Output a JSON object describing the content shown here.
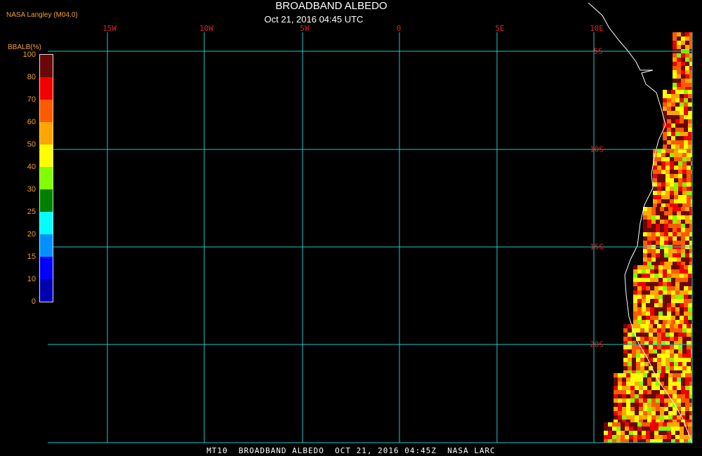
{
  "header": {
    "title": "BROADBAND ALBEDO",
    "subtitle": "Oct 21, 2016 04:45 UTC",
    "credit": "NASA Langley (M04.0)"
  },
  "legend": {
    "unit_label": "BBALB(%)",
    "ticks": [
      "100",
      "80",
      "70",
      "60",
      "50",
      "40",
      "30",
      "25",
      "20",
      "15",
      "10",
      "0"
    ],
    "colors": [
      "#6a0808",
      "#f00000",
      "#ff5a00",
      "#ffa500",
      "#ffff00",
      "#80ff00",
      "#008000",
      "#00ffff",
      "#0090ff",
      "#0000ff",
      "#0000b0",
      "#9030e0"
    ]
  },
  "grid": {
    "color": "#20c8c8",
    "lon_labels": [
      "15W",
      "10W",
      "5W",
      "0",
      "5E",
      "10E"
    ],
    "lat_labels": [
      "5S",
      "10S",
      "15S",
      "20S"
    ]
  },
  "footer": {
    "text": "MT10  BROADBAND ALBEDO  OCT 21, 2016 04:45Z  NASA LARC"
  }
}
